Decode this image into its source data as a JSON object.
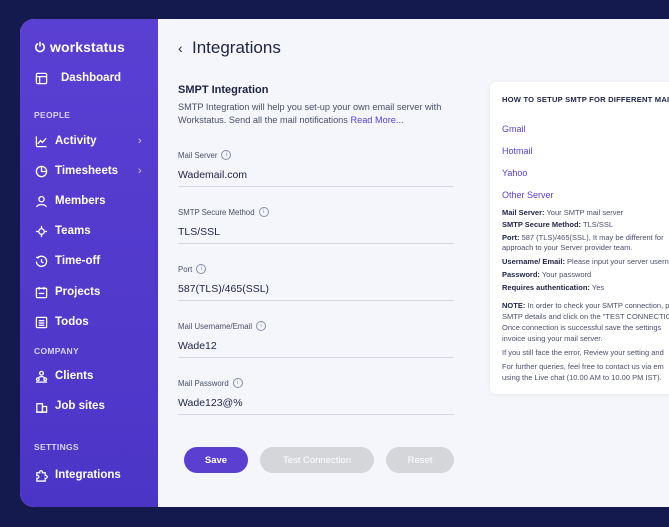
{
  "brand": {
    "name": "workstatus"
  },
  "sidebar": {
    "dashboard": "Dashboard",
    "section_people": "PEOPLE",
    "people": [
      {
        "label": "Activity",
        "icon": "activity-icon"
      },
      {
        "label": "Timesheets",
        "icon": "clock-icon"
      },
      {
        "label": "Members",
        "icon": "user-icon"
      },
      {
        "label": "Teams",
        "icon": "teams-icon"
      },
      {
        "label": "Time-off",
        "icon": "time-off-icon"
      },
      {
        "label": "Projects",
        "icon": "folder-icon"
      },
      {
        "label": "Todos",
        "icon": "list-icon"
      }
    ],
    "section_company": "COMPANY",
    "company": [
      {
        "label": "Clients",
        "icon": "clients-icon"
      },
      {
        "label": "Job sites",
        "icon": "building-icon"
      }
    ],
    "section_settings": "SETTINGS",
    "settings": [
      {
        "label": "Integrations",
        "icon": "puzzle-icon"
      }
    ]
  },
  "header": {
    "title": "Integrations",
    "back": "‹"
  },
  "form": {
    "heading": "SMPT Integration",
    "description": "SMTP Integration will help you set-up your own email server with Workstatus. Send all the mail notifications",
    "read_more": "Read More...",
    "fields": [
      {
        "label": "Mail Server",
        "value": "Wademail.com"
      },
      {
        "label": "SMTP Secure Method",
        "value": "TLS/SSL"
      },
      {
        "label": "Port",
        "value": "587(TLS)/465(SSL)"
      },
      {
        "label": "Mail Username/Email",
        "value": "Wade12"
      },
      {
        "label": "Mail Password",
        "value": "Wade123@%"
      }
    ],
    "save": "Save",
    "test": "Test Connection",
    "reset": "Reset"
  },
  "help": {
    "title": "HOW TO SETUP SMTP FOR DIFFERENT MAIL SE",
    "links": [
      "Gmail",
      "Hotmail",
      "Yahoo",
      "Other Server"
    ],
    "lines": [
      {
        "bold": "Mail Server:",
        "text": " Your SMTP mail server"
      },
      {
        "bold": "SMTP Secure Method:",
        "text": " TLS/SSL"
      },
      {
        "bold": "Port:",
        "text": " 587 (TLS)/465(SSL), It may be different for"
      },
      {
        "bold": "",
        "text": "approach to your Server provider team."
      },
      {
        "bold": "Username/ Email:",
        "text": " Please input your server userna"
      },
      {
        "bold": "Password:",
        "text": " Your password"
      },
      {
        "bold": "Requires authentication:",
        "text": " Yes"
      },
      {
        "bold": "NOTE:",
        "text": " In order to check your SMTP connection, p"
      },
      {
        "bold": "",
        "text": "SMTP details and click on the \"TEST CONNECTIO"
      },
      {
        "bold": "",
        "text": "Once connection is successful save the settings"
      },
      {
        "bold": "",
        "text": "invoice using your mail server."
      },
      {
        "bold": "",
        "text": "If you still face the error, Review your setting and"
      },
      {
        "bold": "",
        "text": "For further queries, feel free to contact us via em"
      },
      {
        "bold": "",
        "text": "using the Live chat (10.00 AM to 10.00 PM IST)."
      }
    ]
  }
}
